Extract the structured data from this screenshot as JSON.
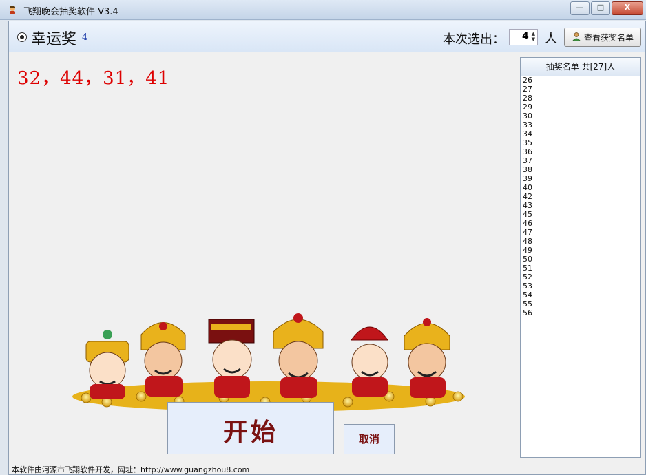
{
  "window": {
    "title": "飞翔晚会抽奖软件 V3.4",
    "minimize_glyph": "—",
    "maximize_glyph": "□",
    "close_glyph": "X"
  },
  "header": {
    "prize_name": "幸运奖",
    "prize_count": "4",
    "select_label": "本次选出：",
    "select_value": "4",
    "people_unit": "人",
    "view_winners_label": "查看获奖名单"
  },
  "result": {
    "numbers": "32，44，31，41"
  },
  "buttons": {
    "start_label": "开始",
    "cancel_label": "取消"
  },
  "panel": {
    "header_label": "抽奖名单 共[27]人",
    "items": [
      "26",
      "27",
      "28",
      "29",
      "30",
      "33",
      "34",
      "35",
      "36",
      "37",
      "38",
      "39",
      "40",
      "42",
      "43",
      "45",
      "46",
      "47",
      "48",
      "49",
      "50",
      "51",
      "52",
      "53",
      "54",
      "55",
      "56"
    ]
  },
  "status": {
    "text": "本软件由河源市飞翔软件开发，网址：http://www.guangzhou8.com"
  },
  "colors": {
    "result_red": "#dd0000",
    "button_text": "#7a1212",
    "accent_blue": "#1a3aa8"
  },
  "icons": {
    "app": "app-icon",
    "person": "person-icon",
    "radio": "radio-icon"
  }
}
